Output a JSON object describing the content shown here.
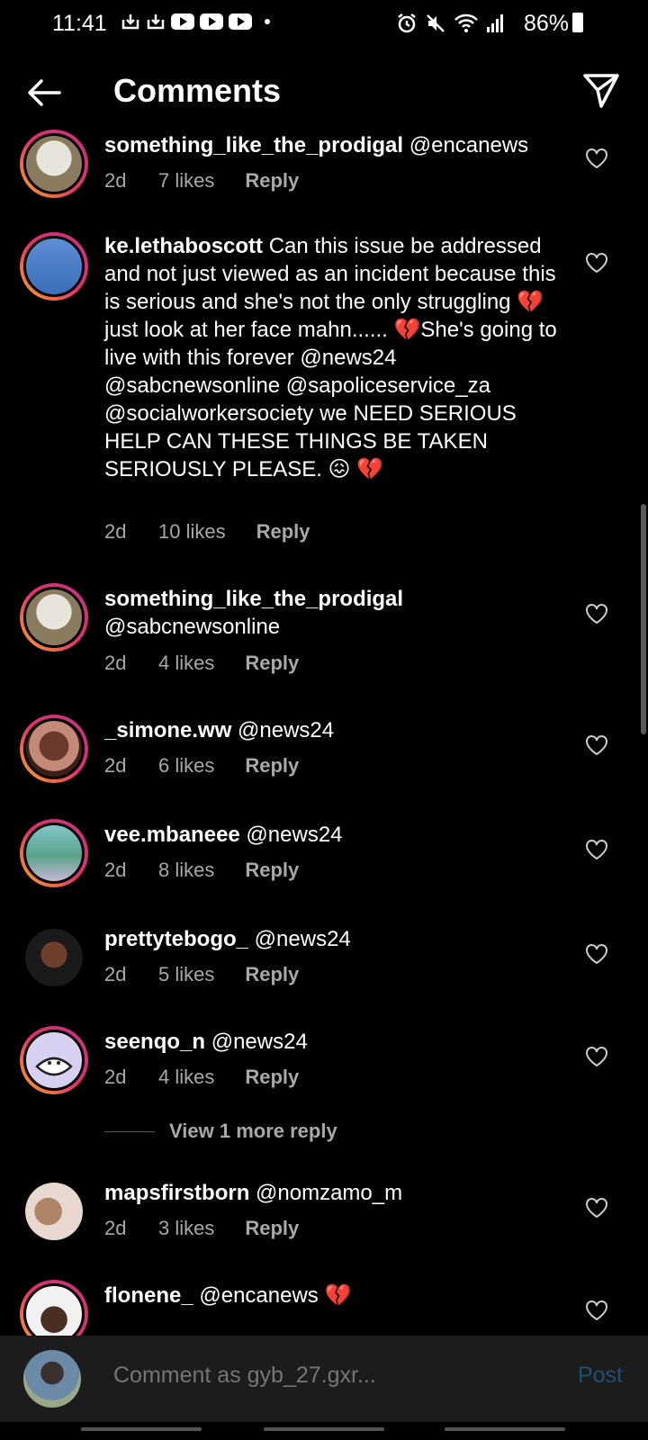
{
  "status_bar": {
    "time": "11:41",
    "battery": "86%"
  },
  "header": {
    "title": "Comments"
  },
  "comments": [
    {
      "user": "something_like_the_prodigal",
      "text": " @encanews",
      "age": "2d",
      "likes": "7 likes",
      "reply": "Reply"
    },
    {
      "user": "ke.lethaboscott",
      "text": " Can this issue be addressed and not just viewed as an incident because this is serious and she's not the only struggling 💔just look at her face mahn...... 💔She's going to live with this forever  @news24 @sabcnewsonline @sapoliceservice_za @socialworkersociety we NEED SERIOUS HELP CAN THESE THINGS BE TAKEN SERIOUSLY PLEASE. 😖 💔",
      "age": "2d",
      "likes": "10 likes",
      "reply": "Reply"
    },
    {
      "user": "something_like_the_prodigal",
      "text": " @sabcnewsonline",
      "age": "2d",
      "likes": "4 likes",
      "reply": "Reply"
    },
    {
      "user": "_simone.ww",
      "text": " @news24",
      "age": "2d",
      "likes": "6 likes",
      "reply": "Reply"
    },
    {
      "user": "vee.mbaneee",
      "text": " @news24",
      "age": "2d",
      "likes": "8 likes",
      "reply": "Reply"
    },
    {
      "user": "prettytebogo_",
      "text": " @news24",
      "age": "2d",
      "likes": "5 likes",
      "reply": "Reply"
    },
    {
      "user": "seenqo_n",
      "text": " @news24",
      "age": "2d",
      "likes": "4 likes",
      "reply": "Reply"
    },
    {
      "user": "mapsfirstborn",
      "text": " @nomzamo_m",
      "age": "2d",
      "likes": "3 likes",
      "reply": "Reply"
    },
    {
      "user": "flonene_",
      "text": " @encanews 💔",
      "age": "",
      "likes": "",
      "reply": ""
    }
  ],
  "view_more_reply": "View 1 more reply",
  "comment_bar": {
    "placeholder": "Comment as gyb_27.gxr...",
    "post_label": "Post"
  },
  "colors": {
    "background": "#000000",
    "meta_text": "#a8a8a8",
    "post_disabled": "#1d4f73",
    "story_ring_start": "#f9a825",
    "story_ring_end": "#c13584"
  }
}
